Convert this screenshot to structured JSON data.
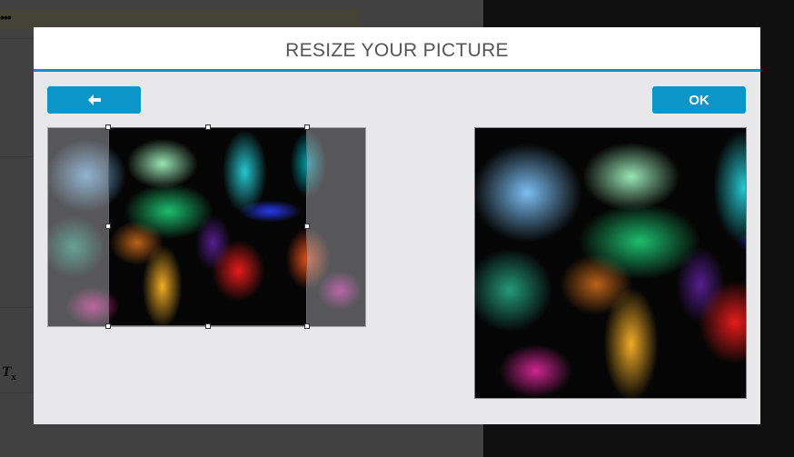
{
  "background": {
    "menu_dots": "•••"
  },
  "modal": {
    "title": "RESIZE YOUR PICTURE",
    "back_icon": "arrow-left-icon",
    "ok_label": "OK"
  },
  "colors": {
    "accent": "#0c95c8",
    "header_rule": "#0e92c4",
    "modal_bg": "#e8e8ea"
  }
}
